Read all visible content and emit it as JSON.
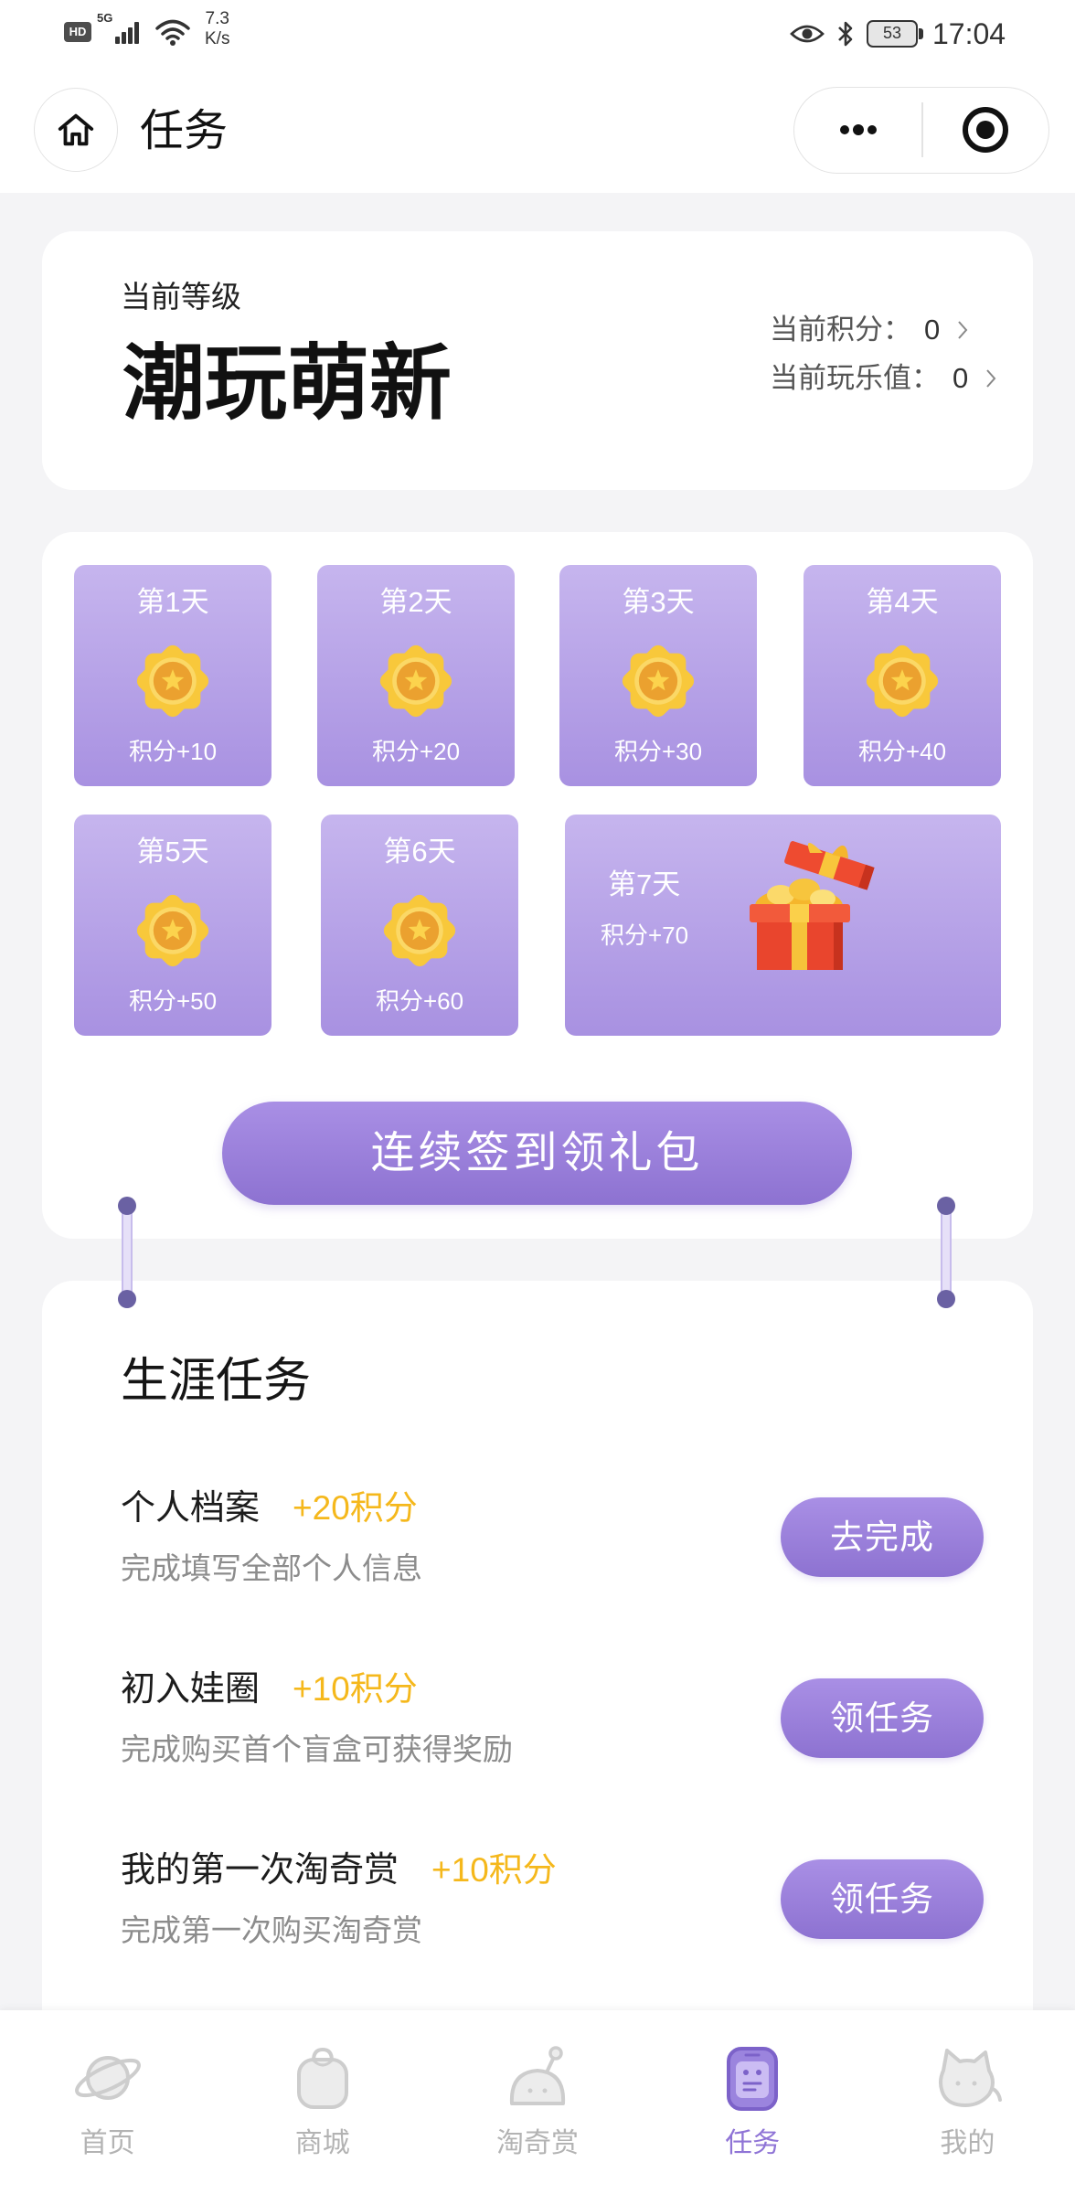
{
  "status_bar": {
    "hd": "HD",
    "network": "5G",
    "speed_value": "7.3",
    "speed_unit": "K/s",
    "battery": "53",
    "time": "17:04"
  },
  "header": {
    "title": "任务",
    "home_icon": "home-icon",
    "menu_icon": "more-dots-icon",
    "close_icon": "target-icon"
  },
  "level_card": {
    "label": "当前等级",
    "level": "潮玩萌新",
    "points_label": "当前积分：",
    "points_value": "0",
    "fun_label": "当前玩乐值：",
    "fun_value": "0"
  },
  "checkin": {
    "days": [
      {
        "day": "第1天",
        "reward": "积分+10",
        "icon": "medal-icon"
      },
      {
        "day": "第2天",
        "reward": "积分+20",
        "icon": "medal-icon"
      },
      {
        "day": "第3天",
        "reward": "积分+30",
        "icon": "medal-icon"
      },
      {
        "day": "第4天",
        "reward": "积分+40",
        "icon": "medal-icon"
      },
      {
        "day": "第5天",
        "reward": "积分+50",
        "icon": "medal-icon"
      },
      {
        "day": "第6天",
        "reward": "积分+60",
        "icon": "medal-icon"
      },
      {
        "day": "第7天",
        "reward": "积分+70",
        "icon": "gift-box-icon"
      }
    ],
    "button_label": "连续签到领礼包"
  },
  "career_tasks": {
    "title": "生涯任务",
    "tasks": [
      {
        "name": "个人档案",
        "points": "+20积分",
        "desc": "完成填写全部个人信息",
        "action": "去完成"
      },
      {
        "name": "初入娃圈",
        "points": "+10积分",
        "desc": "完成购买首个盲盒可获得奖励",
        "action": "领任务"
      },
      {
        "name": "我的第一次淘奇赏",
        "points": "+10积分",
        "desc": "完成第一次购买淘奇赏",
        "action": "领任务"
      }
    ]
  },
  "tab_bar": {
    "items": [
      {
        "label": "首页",
        "icon": "planet-icon",
        "active": false
      },
      {
        "label": "商城",
        "icon": "bag-icon",
        "active": false
      },
      {
        "label": "淘奇赏",
        "icon": "blob-antenna-icon",
        "active": false
      },
      {
        "label": "任务",
        "icon": "task-icon",
        "active": true
      },
      {
        "label": "我的",
        "icon": "cat-icon",
        "active": false
      }
    ]
  },
  "colors": {
    "accent": "#8f74d6",
    "points": "#f5b81c",
    "tile_top": "#c6b5ee",
    "tile_bottom": "#a891e1",
    "button_top": "#a98fe5",
    "button_bottom": "#8d72d1"
  }
}
